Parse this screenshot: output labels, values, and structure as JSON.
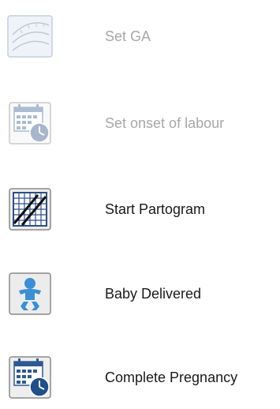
{
  "menu": {
    "items": [
      {
        "label": "Set GA",
        "icon": "ga-wheel-icon",
        "enabled": false
      },
      {
        "label": "Set onset of labour",
        "icon": "calendar-clock-icon",
        "enabled": false
      },
      {
        "label": "Start Partogram",
        "icon": "partogram-chart-icon",
        "enabled": true
      },
      {
        "label": "Baby Delivered",
        "icon": "baby-icon",
        "enabled": true
      },
      {
        "label": "Complete Pregnancy",
        "icon": "calendar-clock-icon",
        "enabled": true
      }
    ]
  }
}
